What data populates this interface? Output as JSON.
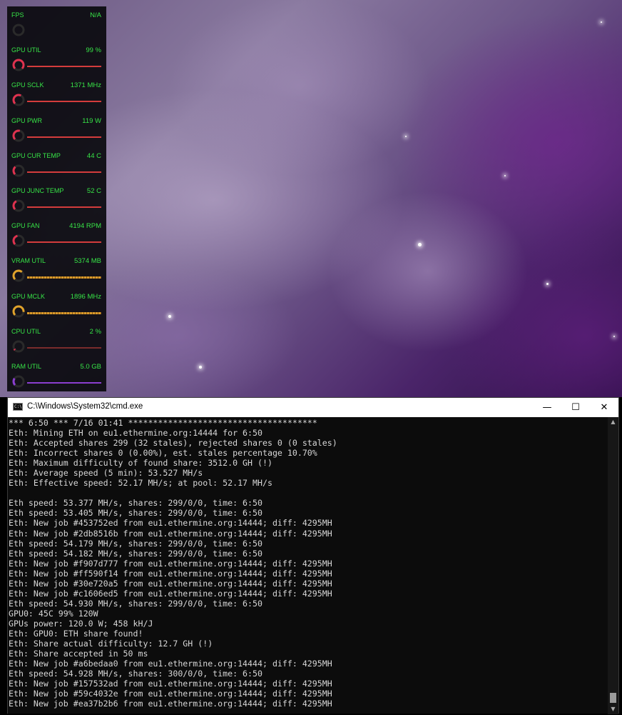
{
  "overlay": {
    "metrics": [
      {
        "label": "FPS",
        "value": "N/A",
        "level": 0.0,
        "gauge_color": "#444444",
        "bar": "none"
      },
      {
        "label": "GPU UTIL",
        "value": "99 %",
        "level": 0.99,
        "gauge_color": "#e0324f",
        "bar": "red"
      },
      {
        "label": "GPU SCLK",
        "value": "1371 MHz",
        "level": 0.6,
        "gauge_color": "#e0324f",
        "bar": "red"
      },
      {
        "label": "GPU PWR",
        "value": "119 W",
        "level": 0.55,
        "gauge_color": "#e0324f",
        "bar": "red"
      },
      {
        "label": "GPU CUR TEMP",
        "value": "44 C",
        "level": 0.35,
        "gauge_color": "#e0324f",
        "bar": "red"
      },
      {
        "label": "GPU JUNC TEMP",
        "value": "52 C",
        "level": 0.4,
        "gauge_color": "#e0324f",
        "bar": "red"
      },
      {
        "label": "GPU FAN",
        "value": "4194 RPM",
        "level": 0.45,
        "gauge_color": "#e0324f",
        "bar": "red"
      },
      {
        "label": "VRAM UTIL",
        "value": "5374 MB",
        "level": 0.65,
        "gauge_color": "#e0a22b",
        "bar": "orange"
      },
      {
        "label": "GPU MCLK",
        "value": "1896 MHz",
        "level": 0.85,
        "gauge_color": "#e0a22b",
        "bar": "orange"
      },
      {
        "label": "CPU UTIL",
        "value": "2 %",
        "level": 0.02,
        "gauge_color": "#e0324f",
        "bar": "dim"
      },
      {
        "label": "RAM UTIL",
        "value": "5.0 GB",
        "level": 0.3,
        "gauge_color": "#8b3ed0",
        "bar": "purple"
      }
    ]
  },
  "cmd": {
    "title": "C:\\Windows\\System32\\cmd.exe",
    "icon_text": "C:\\",
    "minimize_glyph": "—",
    "maximize_glyph": "☐",
    "close_glyph": "✕",
    "lines": [
      "*** 6:50 *** 7/16 01:41 **************************************",
      "Eth: Mining ETH on eu1.ethermine.org:14444 for 6:50",
      "Eth: Accepted shares 299 (32 stales), rejected shares 0 (0 stales)",
      "Eth: Incorrect shares 0 (0.00%), est. stales percentage 10.70%",
      "Eth: Maximum difficulty of found share: 3512.0 GH (!)",
      "Eth: Average speed (5 min): 53.527 MH/s",
      "Eth: Effective speed: 52.17 MH/s; at pool: 52.17 MH/s",
      "",
      "Eth speed: 53.377 MH/s, shares: 299/0/0, time: 6:50",
      "Eth speed: 53.405 MH/s, shares: 299/0/0, time: 6:50",
      "Eth: New job #453752ed from eu1.ethermine.org:14444; diff: 4295MH",
      "Eth: New job #2db8516b from eu1.ethermine.org:14444; diff: 4295MH",
      "Eth speed: 54.179 MH/s, shares: 299/0/0, time: 6:50",
      "Eth speed: 54.182 MH/s, shares: 299/0/0, time: 6:50",
      "Eth: New job #f907d777 from eu1.ethermine.org:14444; diff: 4295MH",
      "Eth: New job #ff590f14 from eu1.ethermine.org:14444; diff: 4295MH",
      "Eth: New job #30e720a5 from eu1.ethermine.org:14444; diff: 4295MH",
      "Eth: New job #c1606ed5 from eu1.ethermine.org:14444; diff: 4295MH",
      "Eth speed: 54.930 MH/s, shares: 299/0/0, time: 6:50",
      "GPU0: 45C 99% 120W",
      "GPUs power: 120.0 W; 458 kH/J",
      "Eth: GPU0: ETH share found!",
      "Eth: Share actual difficulty: 12.7 GH (!)",
      "Eth: Share accepted in 50 ms",
      "Eth: New job #a6bedaa0 from eu1.ethermine.org:14444; diff: 4295MH",
      "Eth speed: 54.928 MH/s, shares: 300/0/0, time: 6:50",
      "Eth: New job #157532ad from eu1.ethermine.org:14444; diff: 4295MH",
      "Eth: New job #59c4032e from eu1.ethermine.org:14444; diff: 4295MH",
      "Eth: New job #ea37b2b6 from eu1.ethermine.org:14444; diff: 4295MH"
    ]
  },
  "colors": {
    "overlay_text": "#37e447",
    "console_text": "#d7d7d7",
    "console_bg": "#0c0c0c"
  }
}
